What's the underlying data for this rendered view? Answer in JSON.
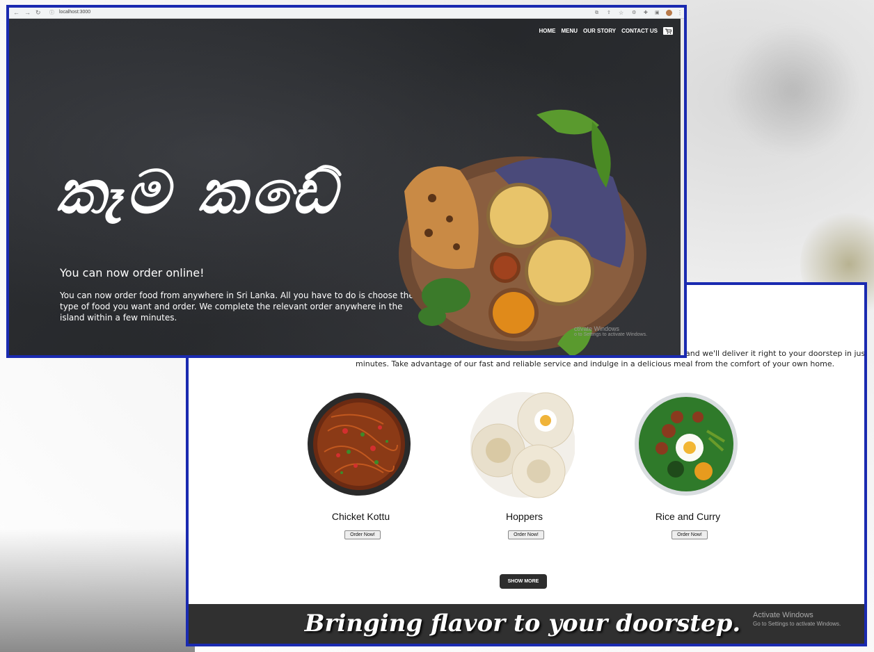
{
  "browser": {
    "url": "localhost:3000"
  },
  "nav": {
    "items": [
      "HOME",
      "MENU",
      "OUR STORY",
      "CONTACT US"
    ]
  },
  "hero": {
    "title": "කෑම කඩේ",
    "subtitle": "You can now order online!",
    "description": "You can now order food from anywhere in Sri Lanka. All you have to do is choose the type of food you want and order. We complete the relevant order anywhere in the island within a few minutes."
  },
  "menu_section": {
    "intro_line_1": "and we'll deliver it right to your doorstep in just a few",
    "intro_line_2": "minutes. Take advantage of our fast and reliable service and indulge in a delicious meal from the comfort of your own home.",
    "items": [
      {
        "name": "Chicket Kottu",
        "button": "Order Now!"
      },
      {
        "name": "Hoppers",
        "button": "Order Now!"
      },
      {
        "name": "Rice and Curry",
        "button": "Order Now!"
      }
    ],
    "show_more": "SHOW MORE"
  },
  "footer": {
    "tagline": "Bringing flavor to your doorstep."
  },
  "watermark": {
    "line1": "Activate Windows",
    "line2": "Go to Settings to activate Windows.",
    "partial_line1": "ctivate Windows",
    "partial_line2": "o to Settings to activate Windows."
  },
  "colors": {
    "frame_border": "#1a2ab0",
    "hero_bg": "#2b2d30",
    "footer_bg": "#303030",
    "button_dark": "#2d2d2d"
  }
}
